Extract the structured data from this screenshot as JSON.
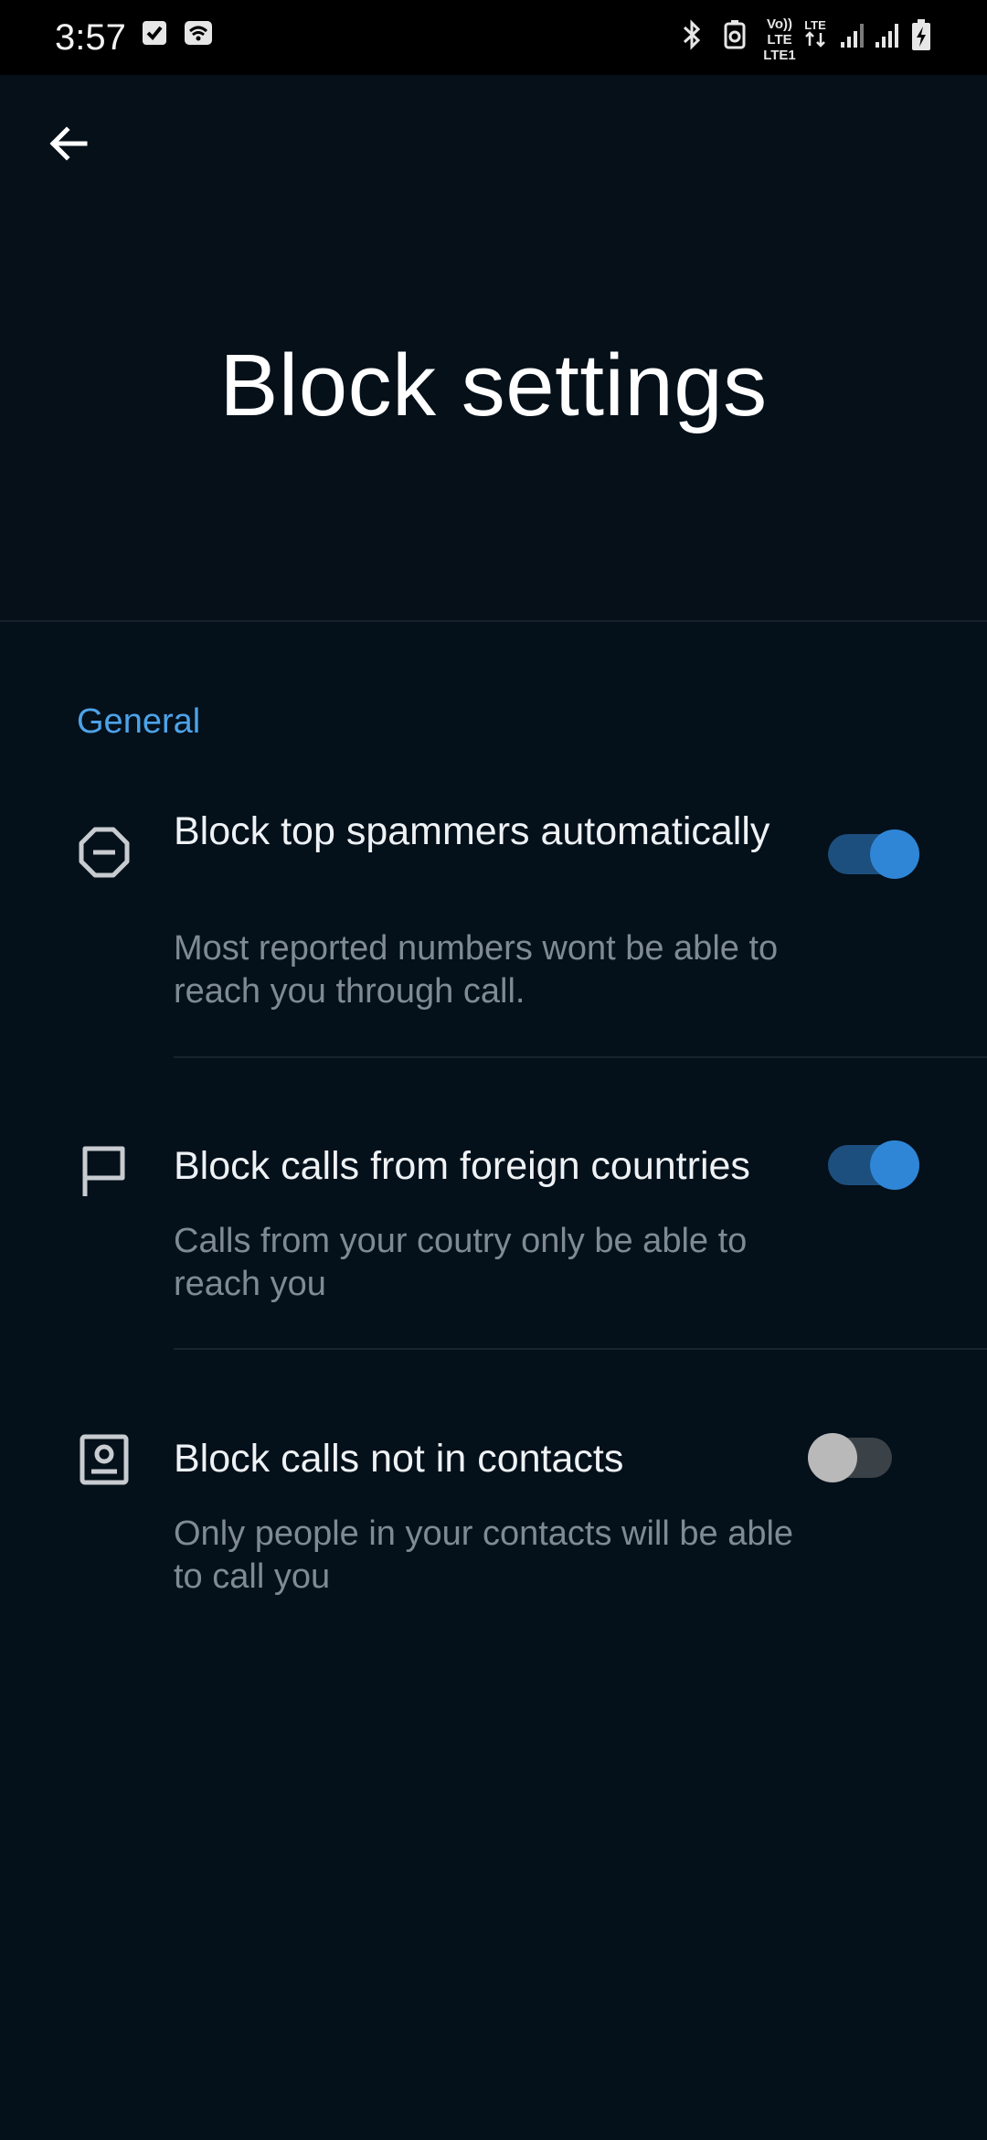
{
  "status_bar": {
    "time": "3:57",
    "network_label_top": "Vo)) LTE",
    "network_label_bottom": "LTE1"
  },
  "header": {
    "title": "Block settings",
    "back_icon": "arrow-left-icon"
  },
  "section": {
    "label": "General"
  },
  "settings": [
    {
      "icon": "minus-octagon-icon",
      "title": "Block top spammers automatically",
      "description": "Most reported numbers wont be able to reach you through call.",
      "enabled": true
    },
    {
      "icon": "flag-icon",
      "title": "Block calls from foreign countries",
      "description": "Calls from your coutry only be able to reach you",
      "enabled": true
    },
    {
      "icon": "contact-card-icon",
      "title": "Block calls not in contacts",
      "description": "Only people in your contacts will be able to call you",
      "enabled": false
    }
  ],
  "colors": {
    "background": "#04101a",
    "accent": "#4da3e8",
    "toggle_on": "#2f86d6",
    "toggle_off": "#b9b9b9"
  }
}
